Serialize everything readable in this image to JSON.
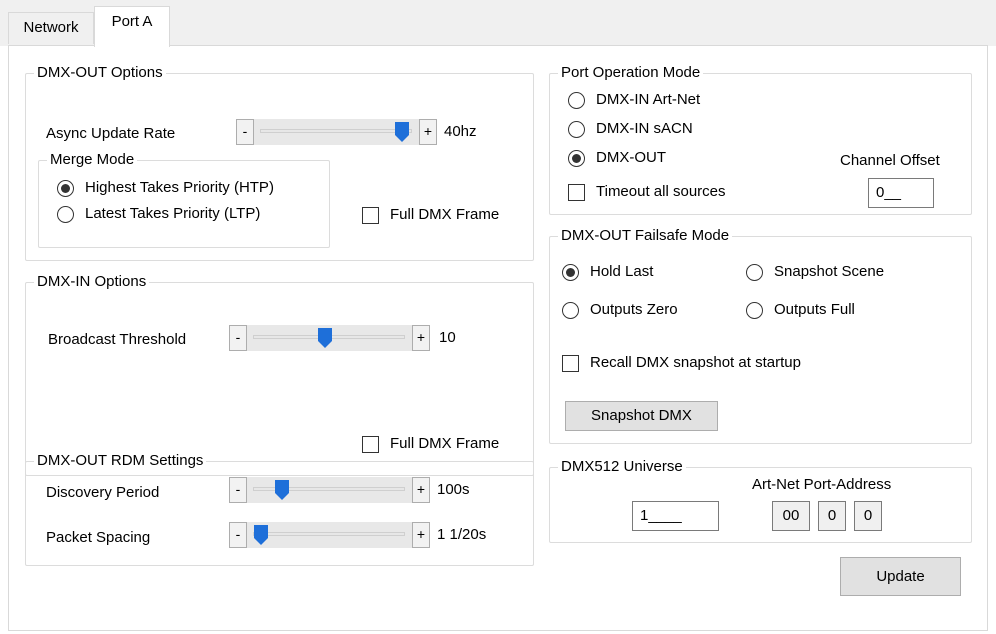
{
  "tabs": [
    {
      "label": "Network"
    },
    {
      "label": "Port A"
    }
  ],
  "dmx_out_options": {
    "title": "DMX-OUT Options",
    "async_label": "Async Update Rate",
    "async_value": "40hz",
    "async_level": 0.95,
    "merge_mode": {
      "title": "Merge Mode",
      "htp_label": "Highest Takes Priority (HTP)",
      "ltp_label": "Latest Takes Priority (LTP)",
      "selected": "htp"
    },
    "full_frame_label": "Full DMX Frame",
    "full_frame_checked": false
  },
  "dmx_in_options": {
    "title": "DMX-IN Options",
    "broadcast_label": "Broadcast Threshold",
    "broadcast_value": "10",
    "broadcast_level": 0.47,
    "full_frame_label": "Full DMX Frame",
    "full_frame_checked": false
  },
  "rdm_settings": {
    "title": "DMX-OUT RDM Settings",
    "discovery_label": "Discovery Period",
    "discovery_value": "100s",
    "discovery_level": 0.17,
    "spacing_label": "Packet Spacing",
    "spacing_value": "1 1/20s",
    "spacing_level": 0.03
  },
  "port_operation": {
    "title": "Port Operation Mode",
    "options": [
      "DMX-IN Art-Net",
      "DMX-IN sACN",
      "DMX-OUT"
    ],
    "selected_index": 2,
    "channel_offset_label": "Channel Offset",
    "channel_offset_value": "0__",
    "timeout_label": "Timeout all sources",
    "timeout_checked": false
  },
  "failsafe": {
    "title": "DMX-OUT Failsafe Mode",
    "hold_last": "Hold Last",
    "snapshot_scene": "Snapshot Scene",
    "outputs_zero": "Outputs Zero",
    "outputs_full": "Outputs Full",
    "selected": "hold_last",
    "recall_label": "Recall DMX snapshot at startup",
    "recall_checked": false,
    "snapshot_button": "Snapshot DMX"
  },
  "universe": {
    "title": "DMX512 Universe",
    "value": "1____",
    "artnet_label": "Art-Net Port-Address",
    "artnet_net": "00",
    "artnet_subnet": "0",
    "artnet_universe": "0"
  },
  "update_button": "Update",
  "colors": {
    "accent": "#1e6fd9",
    "border": "#dcdcdc",
    "button_bg": "#e1e1e1"
  }
}
